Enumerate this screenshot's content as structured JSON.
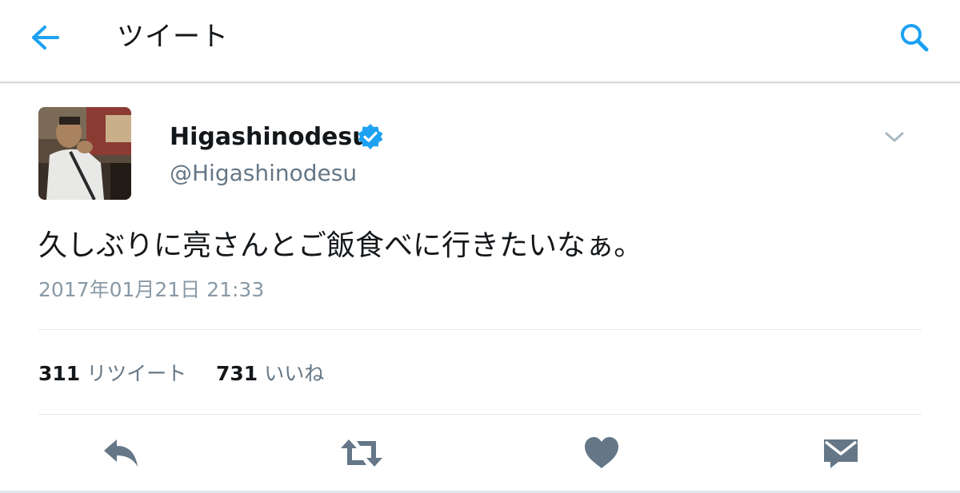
{
  "header": {
    "title": "ツイート",
    "back_icon": "arrow-left-icon",
    "search_icon": "search-icon",
    "accent_color": "#1da1f2"
  },
  "tweet": {
    "author": {
      "display_name": "Higashinodesu",
      "handle": "@Higashinodesu",
      "verified": true,
      "verified_color": "#1da1f2"
    },
    "text": "久しぶりに亮さんとご飯食べに行きたいなぁ。",
    "timestamp": "2017年01月21日 21:33",
    "stats": {
      "retweets": {
        "count": "311",
        "label": "リツイート"
      },
      "likes": {
        "count": "731",
        "label": "いいね"
      }
    },
    "actions": [
      "reply-icon",
      "retweet-icon",
      "heart-icon",
      "direct-message-icon"
    ],
    "action_color": "#657786"
  }
}
